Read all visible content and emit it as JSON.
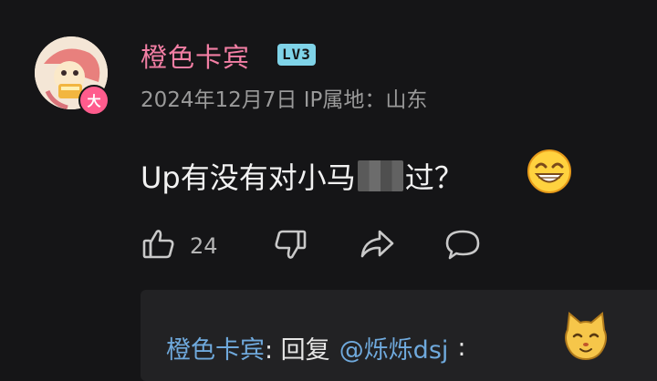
{
  "comment": {
    "username": "橙色卡宾",
    "level_badge": "LV3",
    "vip_badge": "大",
    "meta": "2024年12月7日 IP属地：山东",
    "text_before": "Up有没有对小马",
    "text_after": "过？",
    "emoji": "grinning-emoji-icon"
  },
  "actions": {
    "like_count": "24",
    "like_icon": "thumbs-up-icon",
    "dislike_icon": "thumbs-down-icon",
    "share_icon": "share-icon",
    "reply_icon": "comment-icon"
  },
  "reply": {
    "author": "橙色卡宾",
    "separator": ": 回复",
    "mention": "@烁烁dsj",
    "colon": ":",
    "emoji": "cat-emoji-icon"
  },
  "colors": {
    "background": "#151517",
    "username": "#f27ea4",
    "level_badge": "#7fd3e8",
    "link": "#6fa9dc",
    "vip_badge": "#ff5c8d"
  }
}
